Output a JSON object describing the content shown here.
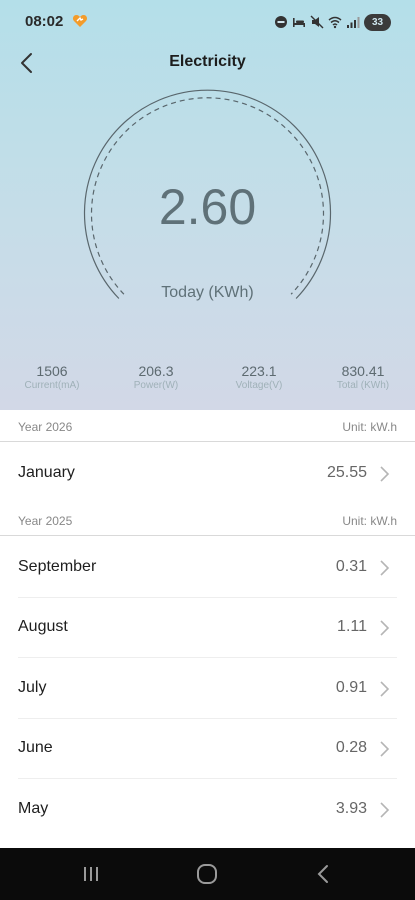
{
  "status_bar": {
    "time": "08:02",
    "battery": "33",
    "icons": [
      "heart-badge-icon",
      "do-not-disturb-icon",
      "bed-icon",
      "mute-icon",
      "wifi-icon",
      "signal-icon",
      "battery-icon"
    ]
  },
  "header": {
    "title": "Electricity",
    "back_icon": "chevron-left-icon"
  },
  "gauge": {
    "value": "2.60",
    "label": "Today (KWh)"
  },
  "stats": [
    {
      "value": "1506",
      "label": "Current(mA)"
    },
    {
      "value": "206.3",
      "label": "Power(W)"
    },
    {
      "value": "223.1",
      "label": "Voltage(V)"
    },
    {
      "value": "830.41",
      "label": "Total (KWh)"
    }
  ],
  "sections": [
    {
      "year": "Year 2026",
      "unit": "Unit: kW.h",
      "months": [
        {
          "name": "January",
          "value": "25.55"
        }
      ]
    },
    {
      "year": "Year 2025",
      "unit": "Unit: kW.h",
      "months": [
        {
          "name": "September",
          "value": "0.31"
        },
        {
          "name": "August",
          "value": "1.11"
        },
        {
          "name": "July",
          "value": "0.91"
        },
        {
          "name": "June",
          "value": "0.28"
        },
        {
          "name": "May",
          "value": "3.93"
        }
      ]
    }
  ],
  "nav_bar": {
    "icons": [
      "recent-apps-icon",
      "home-icon",
      "back-icon"
    ]
  },
  "colors": {
    "hero_top": "#b4dfe9",
    "hero_bottom": "#d2d8e7",
    "gauge_text": "#5f7178",
    "nav_bg": "#0b0b0b"
  }
}
